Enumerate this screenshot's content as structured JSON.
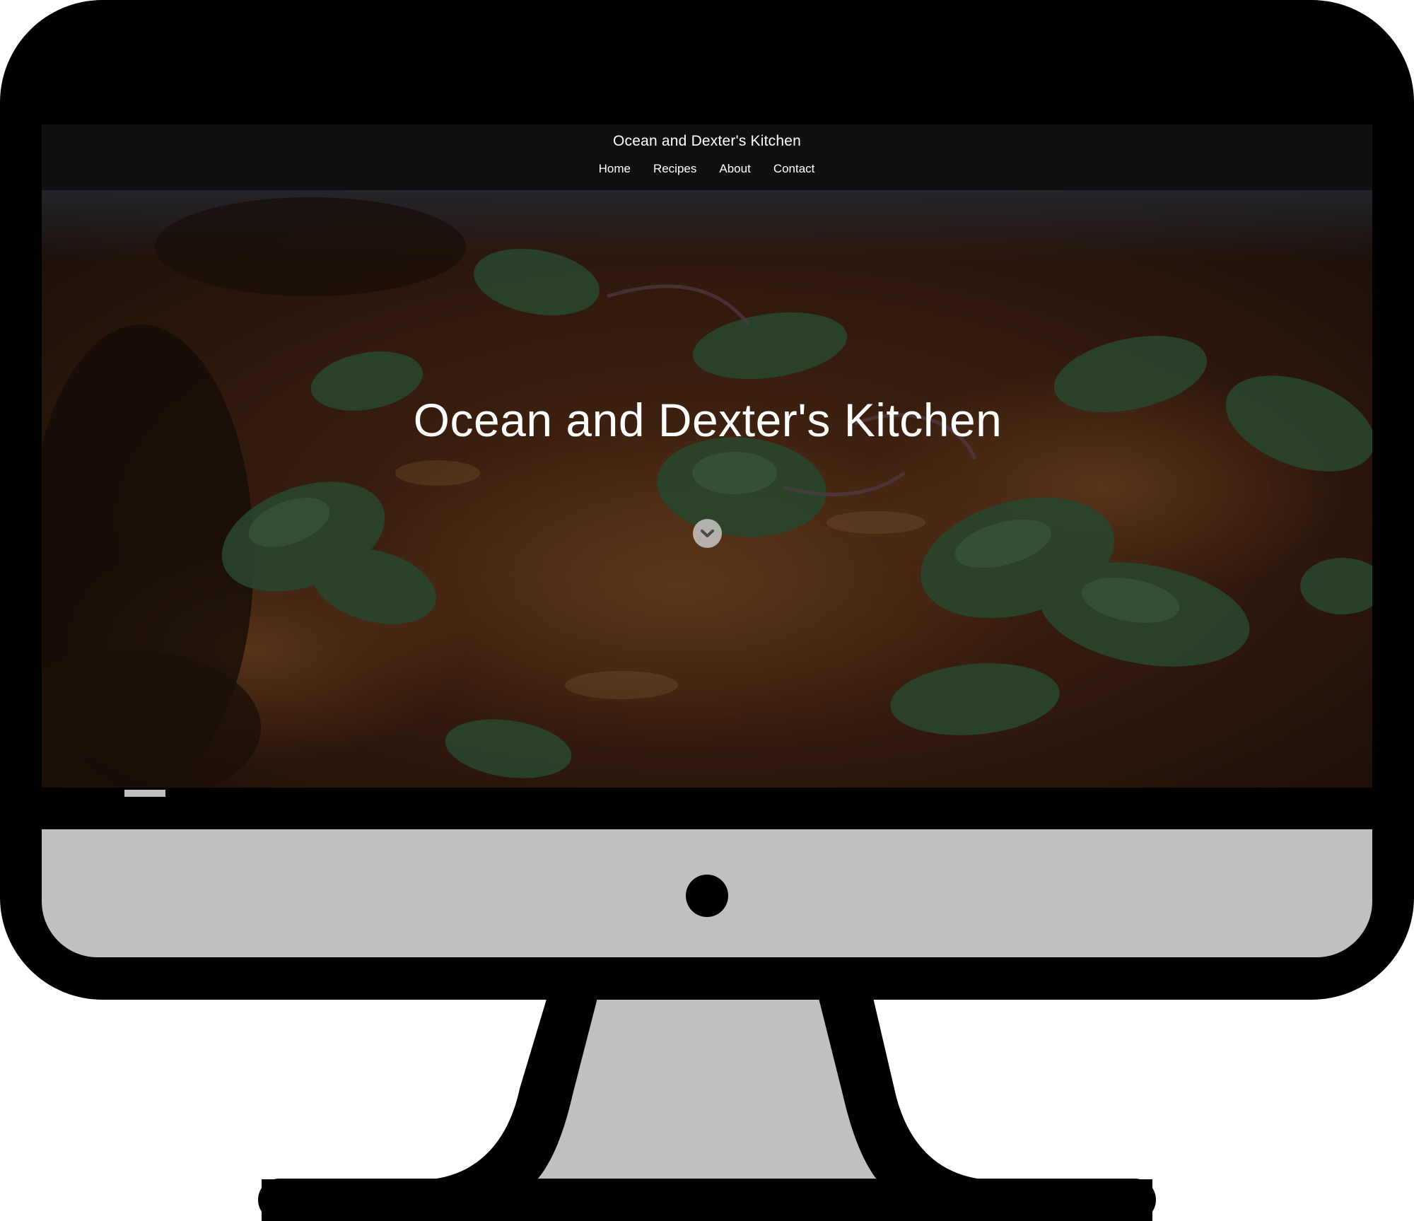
{
  "site": {
    "title": "Ocean and Dexter's Kitchen"
  },
  "nav": {
    "items": [
      "Home",
      "Recipes",
      "About",
      "Contact"
    ]
  },
  "hero": {
    "title": "Ocean and Dexter's Kitchen",
    "scroll_icon": "chevron-down-icon"
  },
  "colors": {
    "header_background": "#101010",
    "monitor_frame": "#000000",
    "monitor_chin": "#c0c0c0",
    "text": "#ffffff"
  }
}
